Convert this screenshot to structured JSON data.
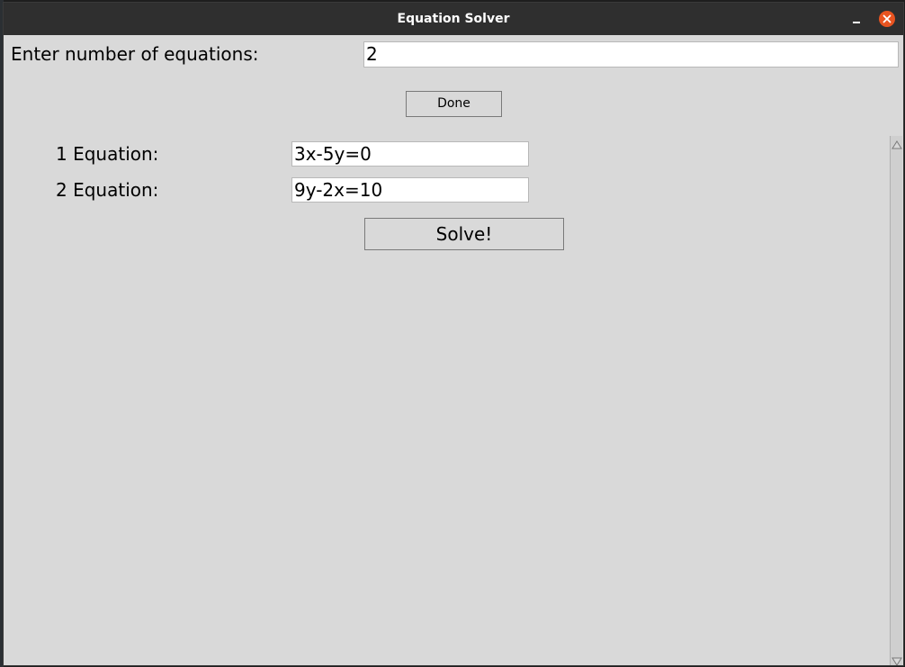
{
  "window": {
    "title": "Equation Solver"
  },
  "icons": {
    "minimize": "minimize-icon",
    "close": "close-icon",
    "scroll_up": "triangle-up-icon",
    "scroll_down": "triangle-down-icon"
  },
  "colors": {
    "titlebar": "#2f2f2f",
    "window_bg": "#d9d9d9",
    "close_button": "#e95420",
    "entry_bg": "#ffffff"
  },
  "form": {
    "count_label": "Enter number of equations:",
    "count_value": "2",
    "done_label": "Done",
    "equations": [
      {
        "label": "1 Equation:",
        "value": "3x-5y=0"
      },
      {
        "label": "2 Equation:",
        "value": "9y-2x=10"
      }
    ],
    "solve_label": "Solve!"
  }
}
